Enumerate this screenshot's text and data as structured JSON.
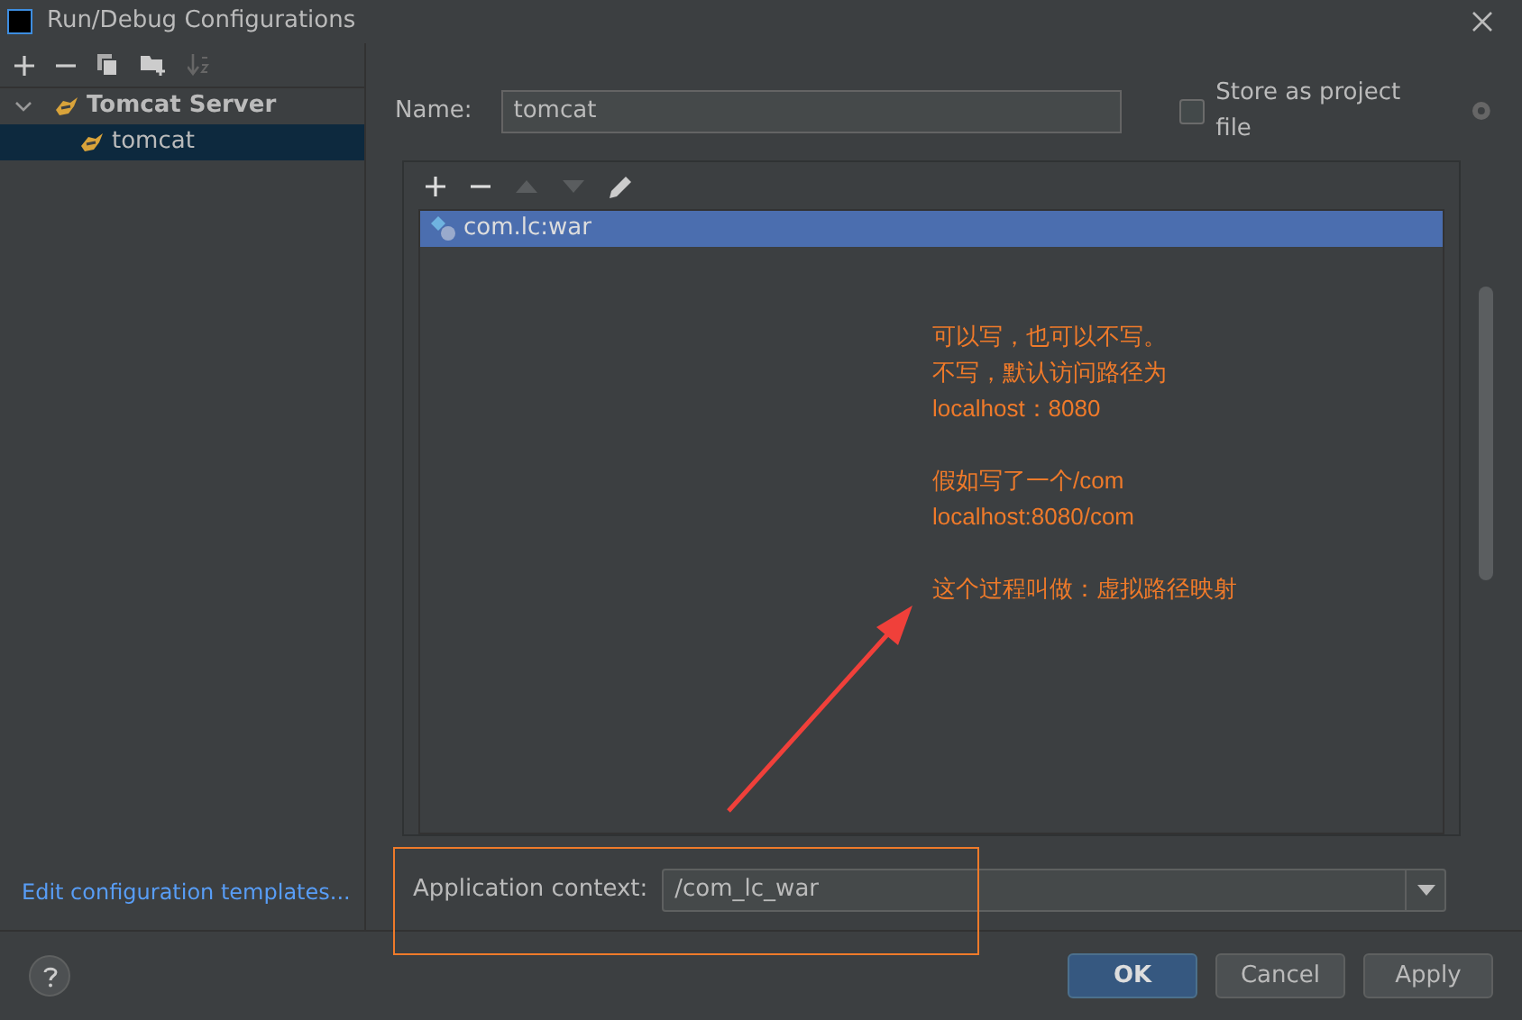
{
  "window": {
    "title": "Run/Debug Configurations"
  },
  "sidebar": {
    "items": [
      {
        "label": "Tomcat Server",
        "expanded": true,
        "selected": false,
        "children": [
          {
            "label": "tomcat",
            "selected": true
          }
        ]
      }
    ],
    "link": "Edit configuration templates..."
  },
  "name_field": {
    "label": "Name:",
    "value": "tomcat"
  },
  "store_as_project_file": {
    "label": "Store as project file",
    "checked": false
  },
  "artifacts": {
    "rows": [
      {
        "label": "com.lc:war",
        "selected": true
      }
    ]
  },
  "annotation": {
    "paragraphs": [
      [
        "可以写，也可以不写。",
        "不写，默认访问路径为",
        "localhost：8080"
      ],
      [
        "假如写了一个/com",
        "localhost:8080/com"
      ],
      [
        "这个过程叫做：虚拟路径映射"
      ]
    ]
  },
  "application_context": {
    "label": "Application context:",
    "value": "/com_lc_war"
  },
  "buttons": [
    {
      "label": "OK",
      "kind": "primary"
    },
    {
      "label": "Cancel",
      "kind": "normal"
    },
    {
      "label": "Apply",
      "kind": "normal"
    }
  ]
}
